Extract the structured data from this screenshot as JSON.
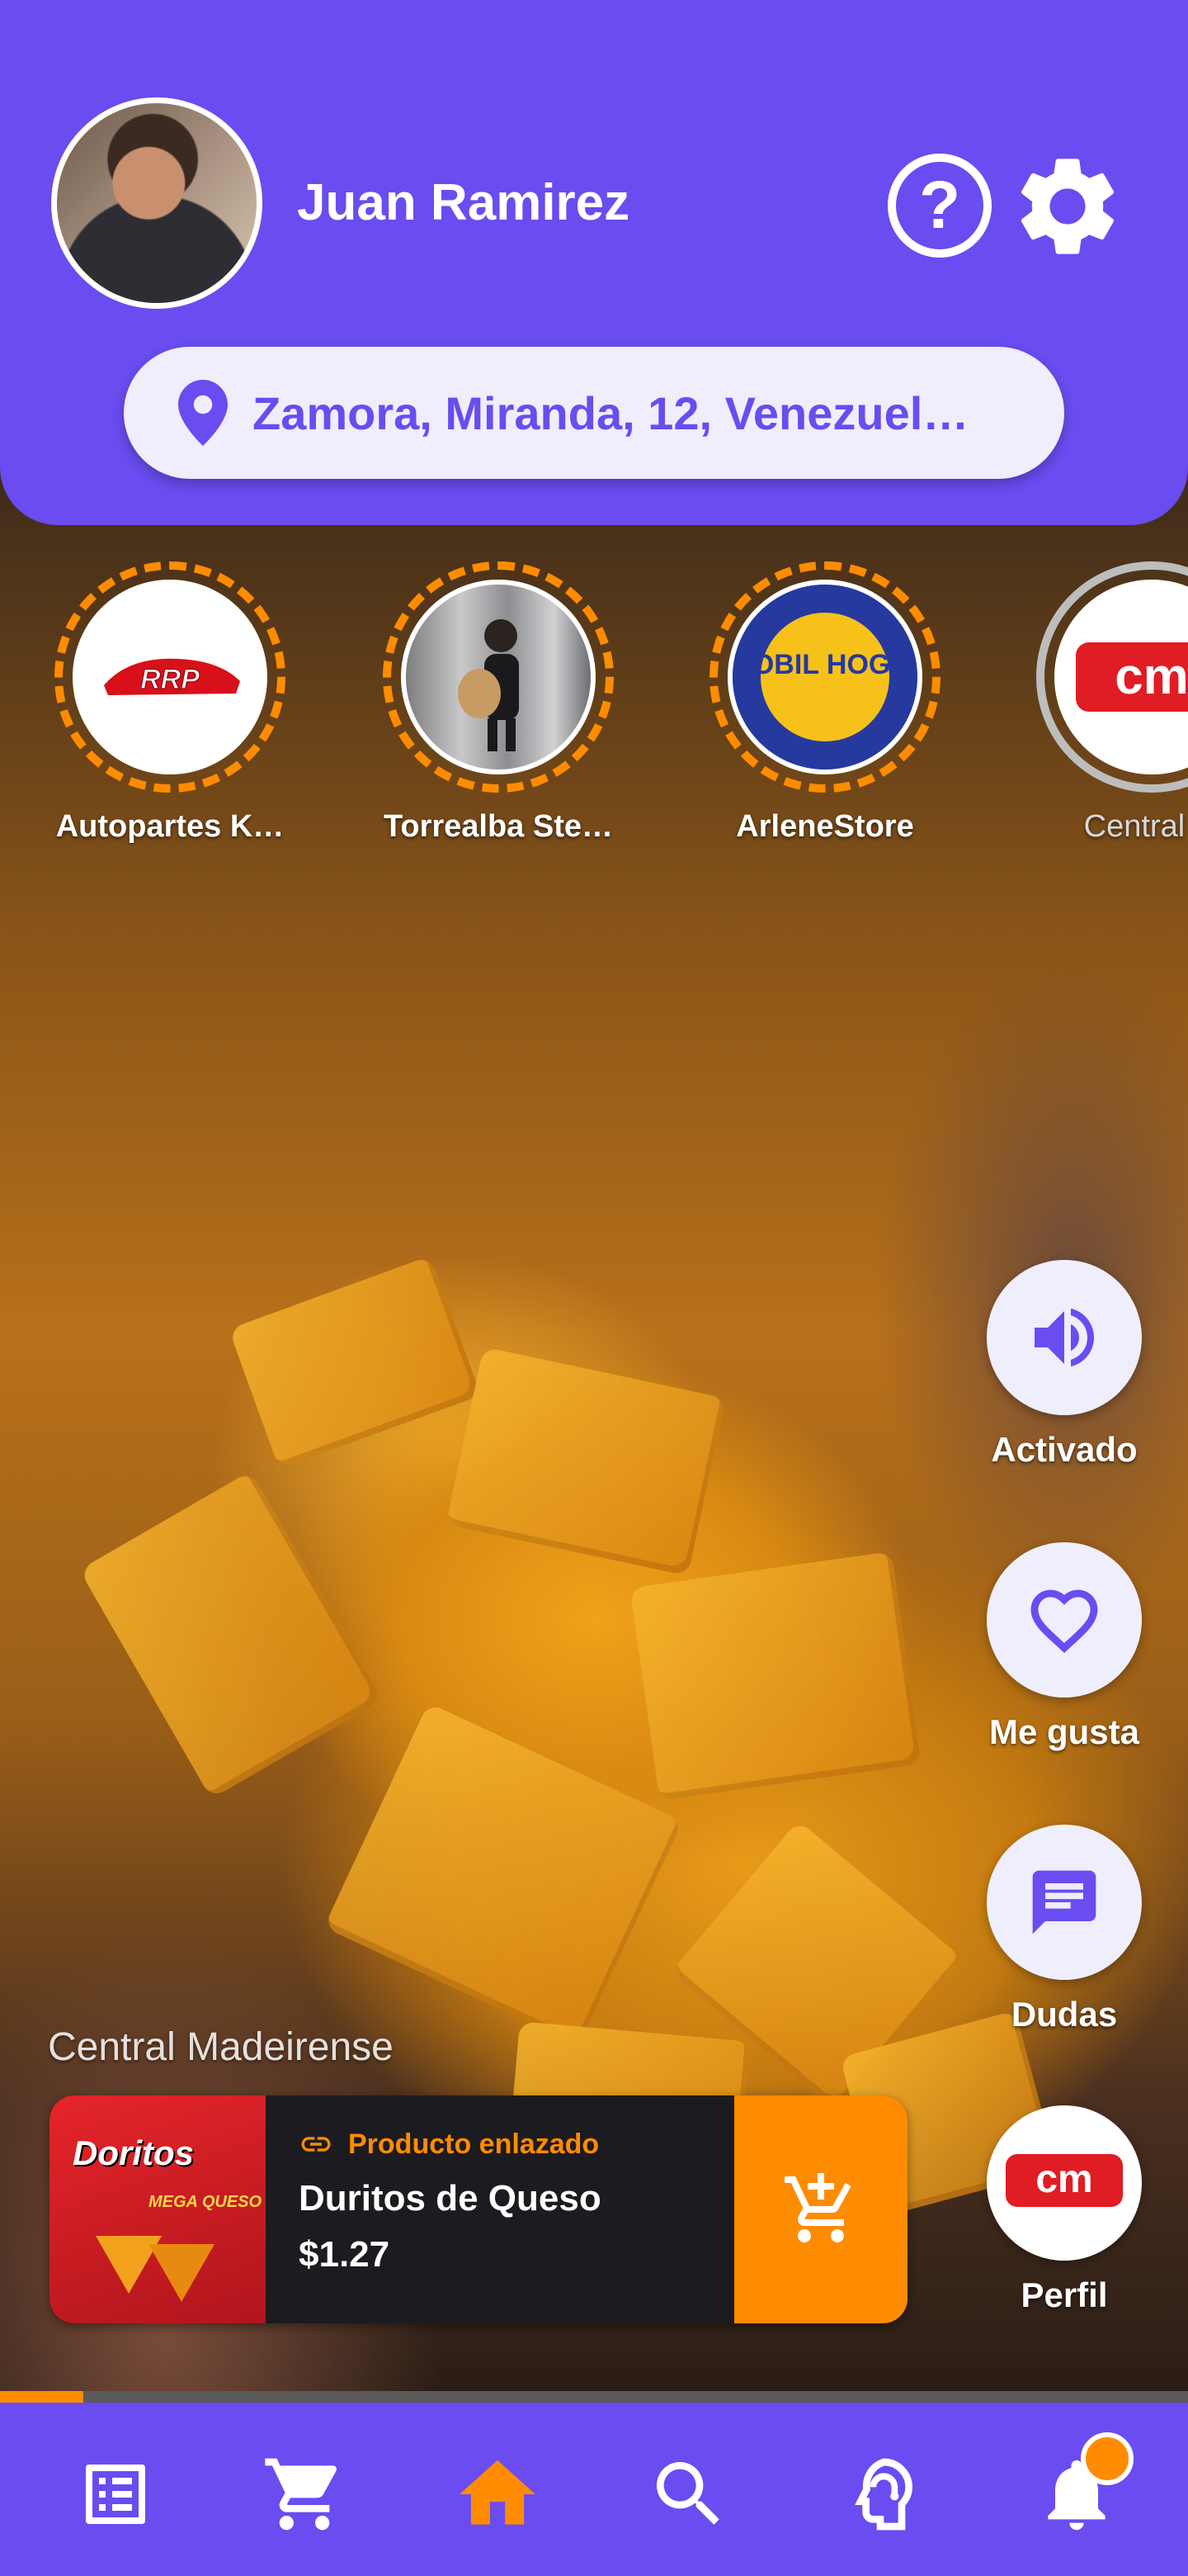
{
  "user": {
    "name": "Juan Ramirez"
  },
  "header": {
    "help_symbol": "?"
  },
  "location": {
    "text": "Zamora, Miranda, 12, Venezuel…"
  },
  "stories": [
    {
      "label": "Autopartes K…",
      "logo_text": "RRP",
      "viewed": false
    },
    {
      "label": "Torrealba Ste…",
      "logo_text": "",
      "viewed": false
    },
    {
      "label": "ArleneStore",
      "logo_text": "MOBIL HOGAR",
      "viewed": false
    },
    {
      "label": "Central M",
      "logo_text": "cm",
      "viewed": true
    }
  ],
  "actions": {
    "sound_label": "Activado",
    "like_label": "Me gusta",
    "questions_label": "Dudas",
    "profile_label": "Perfil",
    "profile_logo_text": "cm"
  },
  "product": {
    "store_name": "Central Madeirense",
    "linked_label": "Producto enlazado",
    "name": "Duritos de Queso",
    "price": "$1.27",
    "image_brand": "Doritos",
    "image_sub": "MEGA QUESO"
  },
  "video": {
    "progress_fraction": 0.07
  },
  "colors": {
    "primary": "#6a4cf0",
    "accent": "#ff8c00",
    "surface": "#efeefd",
    "card": "#1c1b1f"
  },
  "bottom_nav": {
    "items": [
      "list-icon",
      "cart-icon",
      "home-icon",
      "search-icon",
      "headset-icon",
      "bell-icon"
    ],
    "active": "home-icon",
    "notification_badge": true
  }
}
